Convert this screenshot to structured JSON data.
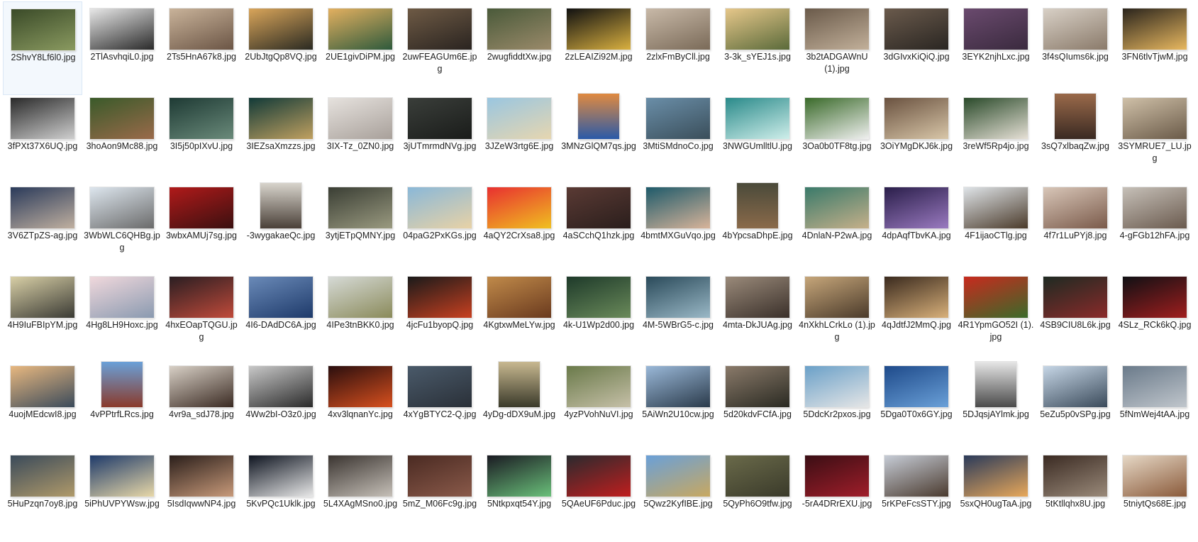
{
  "window": {
    "view": "Large icons",
    "selected_index": 0
  },
  "files": [
    {
      "name": "2ShvY8Lf6l0.jpg",
      "orientation": "landscape",
      "colors": [
        "#3a4a28",
        "#8a9a60"
      ]
    },
    {
      "name": "2TlAsvhqiL0.jpg",
      "orientation": "landscape",
      "colors": [
        "#e8e8e8",
        "#2a2a2a"
      ]
    },
    {
      "name": "2Ts5HnA67k8.jpg",
      "orientation": "landscape",
      "colors": [
        "#c9b39a",
        "#6b5545"
      ]
    },
    {
      "name": "2UbJtgQp8VQ.jpg",
      "orientation": "landscape",
      "colors": [
        "#d9a55a",
        "#2a2a22"
      ]
    },
    {
      "name": "2UE1givDiPM.jpg",
      "orientation": "landscape",
      "colors": [
        "#e3b060",
        "#2e5a3c"
      ]
    },
    {
      "name": "2uwFEAGUm6E.jpg",
      "orientation": "landscape",
      "colors": [
        "#6e5a45",
        "#2a2420"
      ]
    },
    {
      "name": "2wugfiddtXw.jpg",
      "orientation": "landscape",
      "colors": [
        "#4a5a3a",
        "#9a8a6a"
      ]
    },
    {
      "name": "2zLEAIZi92M.jpg",
      "orientation": "landscape",
      "colors": [
        "#111111",
        "#d9b040"
      ]
    },
    {
      "name": "2zlxFmByCll.jpg",
      "orientation": "landscape",
      "colors": [
        "#c8b9a8",
        "#7a6a58"
      ]
    },
    {
      "name": "3-3k_sYEJ1s.jpg",
      "orientation": "landscape",
      "colors": [
        "#e6c78a",
        "#5a6a3a"
      ]
    },
    {
      "name": "3b2tADGAWnU (1).jpg",
      "orientation": "landscape",
      "colors": [
        "#6a5a4a",
        "#c2b09a"
      ]
    },
    {
      "name": "3dGIvxKiQiQ.jpg",
      "orientation": "landscape",
      "colors": [
        "#6a5a4c",
        "#2a2622"
      ]
    },
    {
      "name": "3EYK2njhLxc.jpg",
      "orientation": "landscape",
      "colors": [
        "#6a4a6e",
        "#3a2a3e"
      ]
    },
    {
      "name": "3f4sQIums6k.jpg",
      "orientation": "landscape",
      "colors": [
        "#d8d0c6",
        "#8a7a6a"
      ]
    },
    {
      "name": "3FN6tlvTjwM.jpg",
      "orientation": "landscape",
      "colors": [
        "#2a241c",
        "#e8b860"
      ]
    },
    {
      "name": "3fPXt37X6UQ.jpg",
      "orientation": "landscape",
      "colors": [
        "#2a2a2a",
        "#cfcfcf"
      ]
    },
    {
      "name": "3hoAon9Mc88.jpg",
      "orientation": "landscape",
      "colors": [
        "#3a5a2a",
        "#9a6a4a"
      ]
    },
    {
      "name": "3I5j50pIXvU.jpg",
      "orientation": "landscape",
      "colors": [
        "#1e3a34",
        "#6a8a7a"
      ]
    },
    {
      "name": "3IEZsaXmzzs.jpg",
      "orientation": "landscape",
      "colors": [
        "#123a38",
        "#c0a060"
      ]
    },
    {
      "name": "3IX-Tz_0ZN0.jpg",
      "orientation": "landscape",
      "colors": [
        "#e6e2de",
        "#a8a09a"
      ]
    },
    {
      "name": "3jUTmrmdNVg.jpg",
      "orientation": "landscape",
      "colors": [
        "#3a3e3a",
        "#1a1c1a"
      ]
    },
    {
      "name": "3JZeW3rtg6E.jpg",
      "orientation": "landscape",
      "colors": [
        "#9ac6e0",
        "#e6d6b0"
      ]
    },
    {
      "name": "3MNzGlQM7qs.jpg",
      "orientation": "portrait",
      "colors": [
        "#e08a40",
        "#2a5aa8"
      ]
    },
    {
      "name": "3MtiSMdnoCo.jpg",
      "orientation": "landscape",
      "colors": [
        "#6a8ea8",
        "#3a4e5a"
      ]
    },
    {
      "name": "3NWGUmlltlU.jpg",
      "orientation": "landscape",
      "colors": [
        "#2a8a8a",
        "#cfeeea"
      ]
    },
    {
      "name": "3Oa0b0TF8tg.jpg",
      "orientation": "landscape",
      "colors": [
        "#3a6a2a",
        "#f0f0f0"
      ]
    },
    {
      "name": "3OiYMgDKJ6k.jpg",
      "orientation": "landscape",
      "colors": [
        "#6a5240",
        "#d8c6a8"
      ]
    },
    {
      "name": "3reWf5Rp4jo.jpg",
      "orientation": "landscape",
      "colors": [
        "#2a4a2a",
        "#e6e0d6"
      ]
    },
    {
      "name": "3sQ7xlbaqZw.jpg",
      "orientation": "portrait",
      "colors": [
        "#9a6a4a",
        "#3a2a22"
      ]
    },
    {
      "name": "3SYMRUE7_LU.jpg",
      "orientation": "landscape",
      "colors": [
        "#cfc0a8",
        "#6a5a48"
      ]
    },
    {
      "name": "3V6ZTpZS-ag.jpg",
      "orientation": "landscape",
      "colors": [
        "#2a3a5a",
        "#c0b0a0"
      ]
    },
    {
      "name": "3WbWLC6QHBg.jpg",
      "orientation": "landscape",
      "colors": [
        "#dde6ee",
        "#6a6a6a"
      ]
    },
    {
      "name": "3wbxAMUj7sg.jpg",
      "orientation": "landscape",
      "colors": [
        "#b01a1a",
        "#3a1010"
      ]
    },
    {
      "name": "-3wygakaeQc.jpg",
      "orientation": "portrait",
      "colors": [
        "#d8d4cc",
        "#4a4038"
      ]
    },
    {
      "name": "3ytjETpQMNY.jpg",
      "orientation": "landscape",
      "colors": [
        "#3a3e34",
        "#9a9a80"
      ]
    },
    {
      "name": "04paG2PxKGs.jpg",
      "orientation": "landscape",
      "colors": [
        "#8ab8d8",
        "#e8d2a6"
      ]
    },
    {
      "name": "4aQY2CrXsa8.jpg",
      "orientation": "landscape",
      "colors": [
        "#e83030",
        "#f0c020"
      ]
    },
    {
      "name": "4aSCchQ1hzk.jpg",
      "orientation": "landscape",
      "colors": [
        "#5a3a34",
        "#2a1e1c"
      ]
    },
    {
      "name": "4bmtMXGuVqo.jpg",
      "orientation": "landscape",
      "colors": [
        "#1e5a6a",
        "#d8b49a"
      ]
    },
    {
      "name": "4bYpcsaDhpE.jpg",
      "orientation": "portrait",
      "colors": [
        "#4a4a3a",
        "#8a6a4a"
      ]
    },
    {
      "name": "4DnlaN-P2wA.jpg",
      "orientation": "landscape",
      "colors": [
        "#3a7a6a",
        "#c6b08a"
      ]
    },
    {
      "name": "4dpAqfTbvKA.jpg",
      "orientation": "landscape",
      "colors": [
        "#2a1e4a",
        "#9a7ac0"
      ]
    },
    {
      "name": "4F1ijaoCTlg.jpg",
      "orientation": "landscape",
      "colors": [
        "#dfe4e8",
        "#4a3a2a"
      ]
    },
    {
      "name": "4f7r1LuPYj8.jpg",
      "orientation": "landscape",
      "colors": [
        "#d8c6b8",
        "#7a5a4a"
      ]
    },
    {
      "name": "4-gFGb12hFA.jpg",
      "orientation": "landscape",
      "colors": [
        "#c6c0b8",
        "#6a5a4e"
      ]
    },
    {
      "name": "4H9IuFBIpYM.jpg",
      "orientation": "landscape",
      "colors": [
        "#d8cfa6",
        "#3a3a34"
      ]
    },
    {
      "name": "4Hg8LH9Hoxc.jpg",
      "orientation": "landscape",
      "colors": [
        "#f0d8dc",
        "#8a9ab0"
      ]
    },
    {
      "name": "4hxEOapTQGU.jpg",
      "orientation": "landscape",
      "colors": [
        "#2a1e22",
        "#c04a3a"
      ]
    },
    {
      "name": "4I6-DAdDC6A.jpg",
      "orientation": "landscape",
      "colors": [
        "#6a8ab8",
        "#1e3a6a"
      ]
    },
    {
      "name": "4IPe3tnBKK0.jpg",
      "orientation": "landscape",
      "colors": [
        "#d6dad6",
        "#8a8a5a"
      ]
    },
    {
      "name": "4jcFu1byopQ.jpg",
      "orientation": "landscape",
      "colors": [
        "#1a1a1a",
        "#c84020"
      ]
    },
    {
      "name": "4KgtxwMeLYw.jpg",
      "orientation": "landscape",
      "colors": [
        "#c08a4a",
        "#6a3a1e"
      ]
    },
    {
      "name": "4k-U1Wp2d00.jpg",
      "orientation": "landscape",
      "colors": [
        "#1e3a2a",
        "#6a8a5a"
      ]
    },
    {
      "name": "4M-5WBrG5-c.jpg",
      "orientation": "landscape",
      "colors": [
        "#2a4a5a",
        "#9ab8c6"
      ]
    },
    {
      "name": "4mta-DkJUAg.jpg",
      "orientation": "landscape",
      "colors": [
        "#9a8a7a",
        "#3a302a"
      ]
    },
    {
      "name": "4nXkhLCrkLo (1).jpg",
      "orientation": "landscape",
      "colors": [
        "#c6a67a",
        "#4a3a2a"
      ]
    },
    {
      "name": "4qJdtfJ2MmQ.jpg",
      "orientation": "landscape",
      "colors": [
        "#3a2a1e",
        "#d8b07a"
      ]
    },
    {
      "name": "4R1YpmGO52I (1).jpg",
      "orientation": "landscape",
      "colors": [
        "#c82a1e",
        "#3a6a2a"
      ]
    },
    {
      "name": "4SB9CIU8L6k.jpg",
      "orientation": "landscape",
      "colors": [
        "#1e2a22",
        "#8a2a2a"
      ]
    },
    {
      "name": "4SLz_RCk6kQ.jpg",
      "orientation": "landscape",
      "colors": [
        "#101014",
        "#a01e1e"
      ]
    },
    {
      "name": "4uojMEdcwI8.jpg",
      "orientation": "landscape",
      "colors": [
        "#e8b880",
        "#3a4a5a"
      ]
    },
    {
      "name": "4vPPtrfLRcs.jpg",
      "orientation": "portrait",
      "colors": [
        "#6aa0d8",
        "#8a3a2a"
      ]
    },
    {
      "name": "4vr9a_sdJ78.jpg",
      "orientation": "landscape",
      "colors": [
        "#d8d0c6",
        "#3a2a22"
      ]
    },
    {
      "name": "4Ww2bI-O3z0.jpg",
      "orientation": "landscape",
      "colors": [
        "#c8c8c8",
        "#2a2a2a"
      ]
    },
    {
      "name": "4xv3lqnanYc.jpg",
      "orientation": "landscape",
      "colors": [
        "#2a0e0e",
        "#d8501e"
      ]
    },
    {
      "name": "4xYgBTYC2-Q.jpg",
      "orientation": "landscape",
      "colors": [
        "#4a5a6a",
        "#2a3038"
      ]
    },
    {
      "name": "4yDg-dDX9uM.jpg",
      "orientation": "portrait",
      "colors": [
        "#c8b890",
        "#3a3a2a"
      ]
    },
    {
      "name": "4yzPVohNuVI.jpg",
      "orientation": "landscape",
      "colors": [
        "#6a7a4a",
        "#c6c0a8"
      ]
    },
    {
      "name": "5AiWn2U10cw.jpg",
      "orientation": "landscape",
      "colors": [
        "#9ab8d8",
        "#2a3a4a"
      ]
    },
    {
      "name": "5d20kdvFCfA.jpg",
      "orientation": "landscape",
      "colors": [
        "#8a7a6a",
        "#2a2a22"
      ]
    },
    {
      "name": "5DdcKr2pxos.jpg",
      "orientation": "landscape",
      "colors": [
        "#6aa0c8",
        "#e6e6e6"
      ]
    },
    {
      "name": "5Dga0T0x6GY.jpg",
      "orientation": "landscape",
      "colors": [
        "#1e4a8a",
        "#6aa0d8"
      ]
    },
    {
      "name": "5DJqsjAYlmk.jpg",
      "orientation": "portrait",
      "colors": [
        "#e6e6e6",
        "#4a4a4a"
      ]
    },
    {
      "name": "5eZu5p0vSPg.jpg",
      "orientation": "landscape",
      "colors": [
        "#c6d6e6",
        "#3a4a5a"
      ]
    },
    {
      "name": "5fNmWej4tAA.jpg",
      "orientation": "landscape",
      "colors": [
        "#6a7a8a",
        "#c0c6cc"
      ]
    },
    {
      "name": "5HuPzqn7oy8.jpg",
      "orientation": "landscape",
      "colors": [
        "#3a4a5a",
        "#b09a6a"
      ]
    },
    {
      "name": "5iPhUVPYWsw.jpg",
      "orientation": "landscape",
      "colors": [
        "#1e3a6a",
        "#e8d8a8"
      ]
    },
    {
      "name": "5IsdIqwwNP4.jpg",
      "orientation": "landscape",
      "colors": [
        "#2a1e1a",
        "#c89a7a"
      ]
    },
    {
      "name": "5KvPQc1Uklk.jpg",
      "orientation": "landscape",
      "colors": [
        "#0e1420",
        "#e8e8e8"
      ]
    },
    {
      "name": "5L4XAgMSno0.jpg",
      "orientation": "landscape",
      "colors": [
        "#3a3430",
        "#c6c0b8"
      ]
    },
    {
      "name": "5mZ_M06Fc9g.jpg",
      "orientation": "landscape",
      "colors": [
        "#4a2a22",
        "#8a5a4a"
      ]
    },
    {
      "name": "5Ntkpxqt54Y.jpg",
      "orientation": "landscape",
      "colors": [
        "#1a1a22",
        "#6ac07a"
      ]
    },
    {
      "name": "5QAeUF6Pduc.jpg",
      "orientation": "landscape",
      "colors": [
        "#2a2a2e",
        "#c01e1e"
      ]
    },
    {
      "name": "5Qwz2KyfIBE.jpg",
      "orientation": "landscape",
      "colors": [
        "#6aa0d8",
        "#c8a860"
      ]
    },
    {
      "name": "5QyPh6O9tfw.jpg",
      "orientation": "landscape",
      "colors": [
        "#6a6a4a",
        "#3a3a2a"
      ]
    },
    {
      "name": "-5rA4DRrEXU.jpg",
      "orientation": "landscape",
      "colors": [
        "#3a0e14",
        "#a01e2a"
      ]
    },
    {
      "name": "5rKPeFcsSTY.jpg",
      "orientation": "landscape",
      "colors": [
        "#c6ccd6",
        "#4a3a2e"
      ]
    },
    {
      "name": "5sxQH0ugTaA.jpg",
      "orientation": "landscape",
      "colors": [
        "#2a3a5a",
        "#e8a85a"
      ]
    },
    {
      "name": "5tKtllqhx8U.jpg",
      "orientation": "landscape",
      "colors": [
        "#3a2a22",
        "#9a8a7a"
      ]
    },
    {
      "name": "5tniytQs68E.jpg",
      "orientation": "landscape",
      "colors": [
        "#e6d8c6",
        "#8a5a3a"
      ]
    }
  ]
}
